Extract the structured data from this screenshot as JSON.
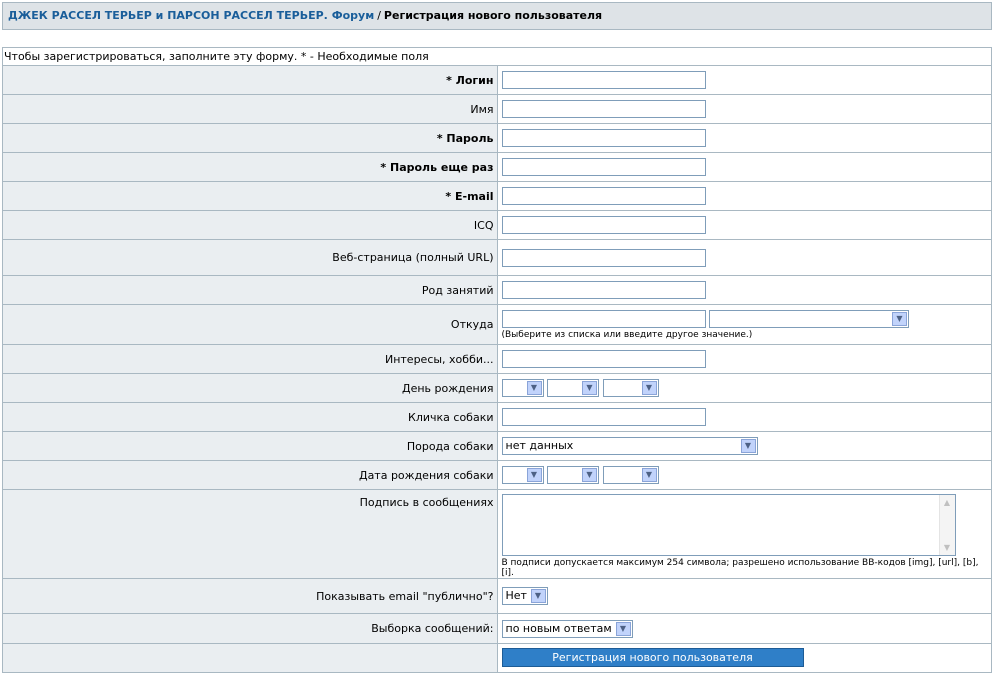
{
  "breadcrumb": {
    "forum": "ДЖЕК РАССЕЛ ТЕРЬЕР и ПАРСОН РАССЕЛ ТЕРЬЕР. Форум",
    "separator": "/",
    "current": "Регистрация нового пользователя"
  },
  "form": {
    "intro": "Чтобы зарегистрироваться, заполните эту форму. * - Необходимые поля",
    "labels": {
      "login": "* Логин",
      "name": "Имя",
      "password": "* Пароль",
      "password_again": "* Пароль еще раз",
      "email": "* E-mail",
      "icq": "ICQ",
      "website": "Веб-страница (полный URL)",
      "occupation": "Род занятий",
      "location": "Откуда",
      "interests": "Интересы, хобби...",
      "birthday": "День рождения",
      "dog_name": "Кличка собаки",
      "dog_breed": "Порода собаки",
      "dog_birthday": "Дата рождения собаки",
      "signature": "Подпись в сообщениях",
      "show_email": "Показывать email \"публично\"?",
      "message_view": "Выборка сообщений:"
    },
    "location_hint": "(Выберите из списка или введите другое значение.)",
    "dog_breed_value": "нет данных",
    "signature_hint": "В подписи допускается максимум 254 символа; разрешено использование BB-кодов [img], [url], [b], [i].",
    "show_email_value": "Нет",
    "message_view_value": "по новым ответам",
    "submit_label": "Регистрация нового пользователя"
  }
}
